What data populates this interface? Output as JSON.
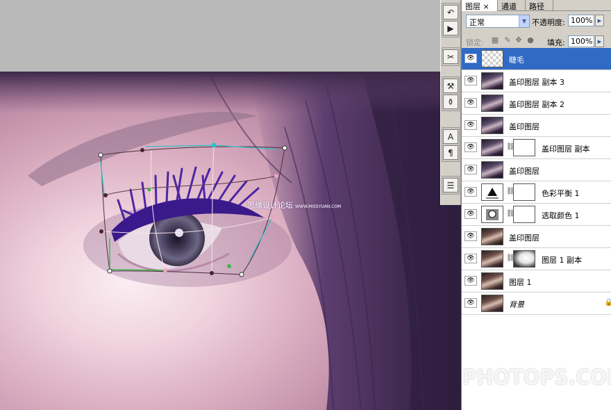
{
  "panel": {
    "tabs": [
      {
        "label": "图层",
        "close": "×",
        "active": true
      },
      {
        "label": "通道",
        "active": false
      },
      {
        "label": "路径",
        "active": false
      }
    ],
    "blend_mode": "正常",
    "opacity_label": "不透明度:",
    "opacity_value": "100%",
    "lock_label": "锁定:",
    "fill_label": "填充:",
    "fill_value": "100%"
  },
  "layers": [
    {
      "name": "睫毛",
      "thumb": "transparent",
      "selected": true
    },
    {
      "name": "盖印图层 副本 3",
      "thumb": "photo"
    },
    {
      "name": "盖印图层 副本 2",
      "thumb": "photo"
    },
    {
      "name": "盖印图层",
      "thumb": "photo"
    },
    {
      "name": "盖印图层 副本",
      "thumb": "photo",
      "mask": "white"
    },
    {
      "name": "盖印图层",
      "thumb": "photo"
    },
    {
      "name": "色彩平衡 1",
      "thumb": "color-balance-icon",
      "mask": "white"
    },
    {
      "name": "选取颜色 1",
      "thumb": "selective-color-icon",
      "mask": "white"
    },
    {
      "name": "盖印图层",
      "thumb": "photo-warm"
    },
    {
      "name": "图层 1 副本",
      "thumb": "photo-warm",
      "mask": "bw"
    },
    {
      "name": "图层 1",
      "thumb": "photo-warm"
    },
    {
      "name": "背景",
      "thumb": "photo-warm",
      "italic": true,
      "locked": true
    }
  ],
  "canvas": {
    "watermark": "思缘设计论坛",
    "watermark_url": "WWW.MISSYUAN.COM",
    "brand": "PHOTOPS.COM"
  },
  "colors": {
    "selection": "#316ac5",
    "panel_bg": "#d4d0c8",
    "workspace": "#b9b9b9"
  }
}
